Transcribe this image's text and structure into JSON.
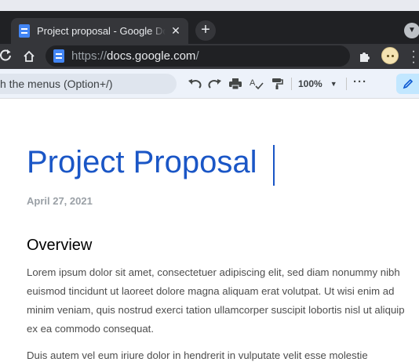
{
  "browser": {
    "tab": {
      "title": "Project proposal - Google Docs",
      "close_glyph": "✕"
    },
    "new_tab_glyph": "+",
    "tab_menu_glyph": "▼",
    "url": {
      "scheme": "https://",
      "host": "docs.google.com",
      "path": "/"
    }
  },
  "toolbar": {
    "menu_search": "h the menus (Option+/)",
    "zoom": "100%",
    "more_glyph": "···",
    "icons": [
      "undo-icon",
      "redo-icon",
      "print-icon",
      "spellcheck-icon",
      "paint-format-icon",
      "edit-pencil-icon"
    ]
  },
  "document": {
    "title": "Project Proposal",
    "date": "April 27, 2021",
    "heading": "Overview",
    "paragraphs": [
      "Lorem ipsum dolor sit amet, consectetuer adipiscing elit, sed diam nonummy nibh euismod tincidunt ut laoreet dolore magna aliquam erat volutpat. Ut wisi enim ad minim veniam, quis nostrud exerci tation ullamcorper suscipit lobortis nisl ut aliquip ex ea commodo consequat.",
      "Duis autem vel eum iriure dolor in hendrerit in vulputate velit esse molestie"
    ]
  },
  "colors": {
    "title_blue": "#1a56c6",
    "chrome_dark": "#202124",
    "docs_toolbar": "#edf2fa",
    "edit_mode": "#c2e7ff"
  }
}
